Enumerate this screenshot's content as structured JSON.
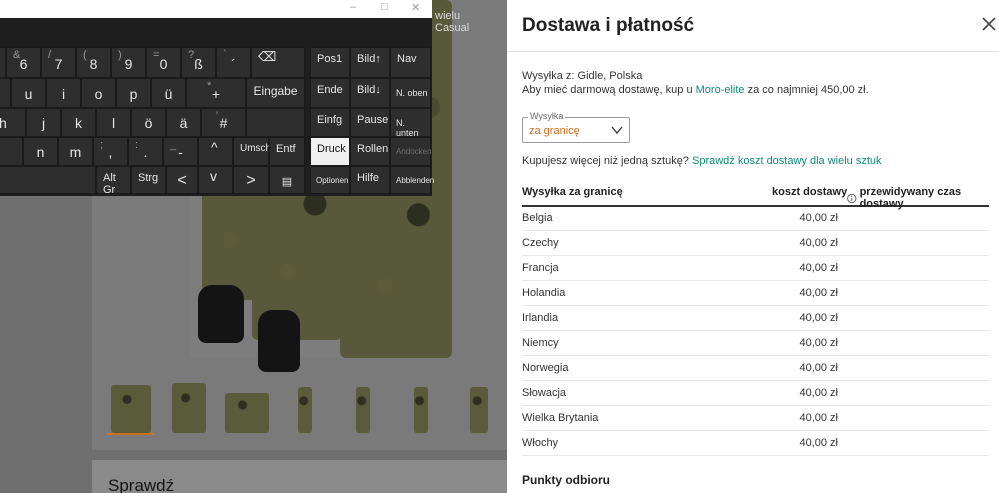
{
  "background_page": {
    "tabs": [
      "wielu",
      "Casual"
    ],
    "section_heading": "Sprawdź"
  },
  "keyboard": {
    "window_controls": [
      "–",
      "□",
      "✕"
    ],
    "keys": [
      {
        "main": "6",
        "top": "&"
      },
      {
        "main": "7",
        "top": "/"
      },
      {
        "main": "8",
        "top": "("
      },
      {
        "main": "9",
        "top": ")"
      },
      {
        "main": "0",
        "top": "="
      },
      {
        "main": "ß",
        "top": "?"
      },
      {
        "main": "´",
        "top": "`"
      },
      {
        "main": "⌫",
        "top": ""
      },
      {
        "main": "u"
      },
      {
        "main": "i"
      },
      {
        "main": "o"
      },
      {
        "main": "p"
      },
      {
        "main": "ü"
      },
      {
        "main": "+",
        "top": "*"
      },
      {
        "main": "Eingabe"
      },
      {
        "main": "h"
      },
      {
        "main": "j"
      },
      {
        "main": "k"
      },
      {
        "main": "l"
      },
      {
        "main": "ö"
      },
      {
        "main": "ä"
      },
      {
        "main": "#",
        "top": "'"
      },
      {
        "main": "n"
      },
      {
        "main": "m"
      },
      {
        "main": ",",
        "top": ";"
      },
      {
        "main": ".",
        "top": ":"
      },
      {
        "main": "-",
        "top": "_"
      },
      {
        "main": "^"
      },
      {
        "main": "Umsch"
      },
      {
        "main": "Entf"
      },
      {
        "main": "Alt Gr"
      },
      {
        "main": "Strg"
      },
      {
        "main": "<"
      },
      {
        "main": "v"
      },
      {
        "main": ">"
      },
      {
        "main": "▤"
      }
    ],
    "nav_keys": [
      "Pos1",
      "Bild↑",
      "Nav",
      "Ende",
      "Bild↓",
      "N. oben",
      "Einfg",
      "Pause",
      "N. unten",
      "Druck",
      "Rollen",
      "Andocken",
      "Optionen",
      "Hilfe",
      "Abblenden"
    ]
  },
  "panel": {
    "title": "Dostawa i płatność",
    "ship_from": "Wysyłka z: Gidle, Polska",
    "free_prefix": "Aby mieć darmową dostawę, kup u ",
    "free_seller": "Moro-elite",
    "free_suffix": " za co najmniej 450,00 zł.",
    "select_label": "Wysyłka",
    "select_value": "za granicę",
    "multi_prefix": "Kupujesz więcej niż jedną sztukę? ",
    "multi_link": "Sprawdź koszt dostawy dla wielu sztuk",
    "table": {
      "headers": [
        "Wysyłka za granicę",
        "koszt dostawy",
        "przewidywany czas dostawy"
      ],
      "rows": [
        {
          "country": "Belgia",
          "cost": "40,00 zł"
        },
        {
          "country": "Czechy",
          "cost": "40,00 zł"
        },
        {
          "country": "Francja",
          "cost": "40,00 zł"
        },
        {
          "country": "Holandia",
          "cost": "40,00 zł"
        },
        {
          "country": "Irlandia",
          "cost": "40,00 zł"
        },
        {
          "country": "Niemcy",
          "cost": "40,00 zł"
        },
        {
          "country": "Norwegia",
          "cost": "40,00 zł"
        },
        {
          "country": "Słowacja",
          "cost": "40,00 zł"
        },
        {
          "country": "Wielka Brytania",
          "cost": "40,00 zł"
        },
        {
          "country": "Włochy",
          "cost": "40,00 zł"
        }
      ]
    },
    "pickup_title": "Punkty odbioru"
  }
}
